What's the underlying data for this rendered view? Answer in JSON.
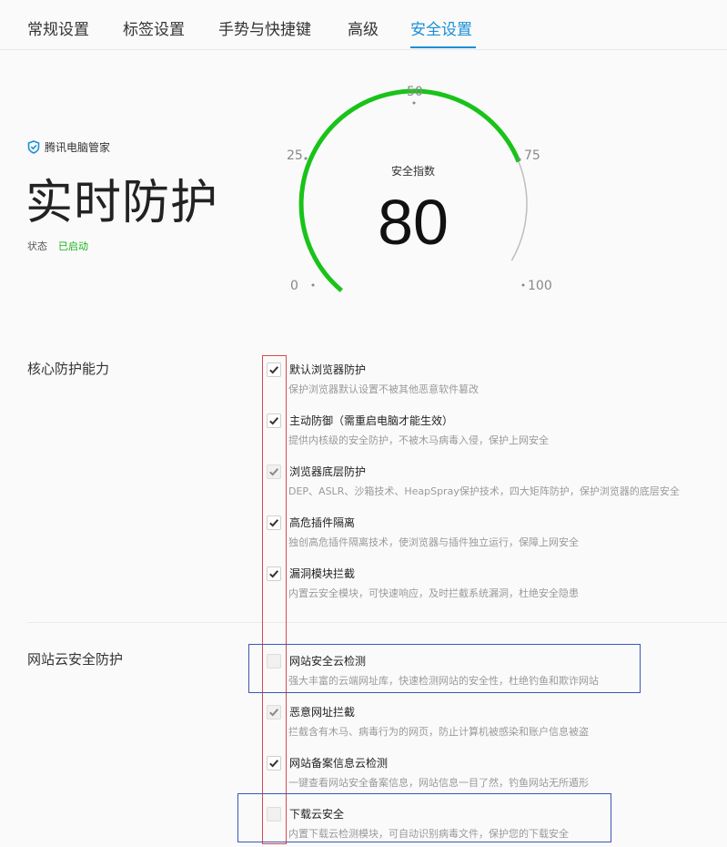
{
  "tabs": [
    {
      "label": "常规设置"
    },
    {
      "label": "标签设置"
    },
    {
      "label": "手势与快捷键"
    },
    {
      "label": "高级"
    },
    {
      "label": "安全设置"
    }
  ],
  "brand": {
    "name": "腾讯电脑管家"
  },
  "hero": {
    "title": "实时防护",
    "status_label": "状态",
    "status_value": "已启动"
  },
  "gauge": {
    "label": "安全指数",
    "value": "80",
    "score": 80,
    "ticks": [
      "0",
      "25",
      "50",
      "75",
      "100"
    ],
    "color": "#19c319"
  },
  "sections": {
    "core": {
      "title": "核心防护能力",
      "options": [
        {
          "title": "默认浏览器防护",
          "desc": "保护浏览器默认设置不被其他恶意软件篡改",
          "checked": true,
          "disabled": false
        },
        {
          "title": "主动防御（需重启电脑才能生效）",
          "desc": "提供内核级的安全防护，不被木马病毒入侵，保护上网安全",
          "checked": true,
          "disabled": false
        },
        {
          "title": "浏览器底层防护",
          "desc": "DEP、ASLR、沙箱技术、HeapSpray保护技术，四大矩阵防护，保护浏览器的底层安全",
          "checked": true,
          "disabled": true
        },
        {
          "title": "高危插件隔离",
          "desc": "独创高危插件隔离技术，使浏览器与插件独立运行，保障上网安全",
          "checked": true,
          "disabled": false
        },
        {
          "title": "漏洞模块拦截",
          "desc": "内置云安全模块，可快速响应，及时拦截系统漏洞，杜绝安全隐患",
          "checked": true,
          "disabled": false
        }
      ]
    },
    "web": {
      "title": "网站云安全防护",
      "options": [
        {
          "title": "网站安全云检测",
          "desc": "强大丰富的云端网址库，快速检测网站的安全性，杜绝钓鱼和欺诈网站",
          "checked": false,
          "disabled": true
        },
        {
          "title": "恶意网址拦截",
          "desc": "拦截含有木马、病毒行为的网页，防止计算机被感染和账户信息被盗",
          "checked": true,
          "disabled": true
        },
        {
          "title": "网站备案信息云检测",
          "desc": "一键查看网站安全备案信息，网站信息一目了然，钓鱼网站无所遁形",
          "checked": true,
          "disabled": false
        },
        {
          "title": "下载云安全",
          "desc": "内置下载云检测模块，可自动识别病毒文件，保护您的下载安全",
          "checked": false,
          "disabled": true
        }
      ]
    }
  }
}
